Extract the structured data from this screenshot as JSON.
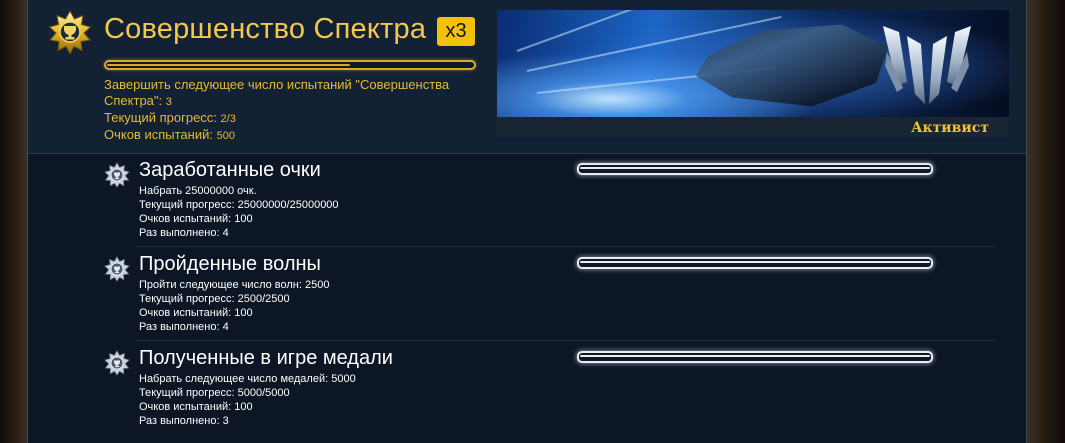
{
  "header": {
    "title": "Совершенство Спектра",
    "multiplier": "x3",
    "desc_line1": "Завершить следующее число испытаний \"Совершенства",
    "desc_line2_label": "Спектра\":",
    "desc_line2_value": "3",
    "progress_label": "Текущий прогресс:",
    "progress_value": "2/3",
    "progress_fraction": 0.667,
    "points_label": "Очков испытаний:",
    "points_value": "500",
    "icon": "trophy-star-icon"
  },
  "banner": {
    "rank": "Активист",
    "emblem": "spectre-emblem-icon"
  },
  "challenges": [
    {
      "title": "Заработанные очки",
      "icon": "star-badge-icon",
      "progress_fraction": 1.0,
      "line1": "Набрать 25000000 очк.",
      "line2": "Текущий прогресс: 25000000/25000000",
      "line3": "Очков испытаний: 100",
      "line4": "Раз выполнено: 4"
    },
    {
      "title": "Пройденные волны",
      "icon": "star-badge-icon",
      "progress_fraction": 1.0,
      "line1": "Пройти следующее число волн: 2500",
      "line2": "Текущий прогресс: 2500/2500",
      "line3": "Очков испытаний: 100",
      "line4": "Раз выполнено: 4"
    },
    {
      "title": "Полученные в игре медали",
      "icon": "star-badge-icon",
      "progress_fraction": 1.0,
      "line1": "Набрать следующее число медалей: 5000",
      "line2": "Текущий прогресс: 5000/5000",
      "line3": "Очков испытаний: 100",
      "line4": "Раз выполнено: 3"
    }
  ],
  "colors": {
    "accent_gold": "#f2c94c",
    "multiplier_bg": "#f2c20a",
    "panel_bg": "#0c1624",
    "header_bg": "#132134"
  }
}
